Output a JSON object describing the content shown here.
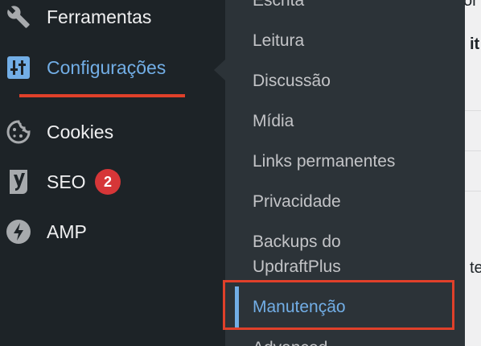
{
  "sidebar": {
    "items": [
      {
        "label": "Ferramentas",
        "icon": "wrench-icon"
      },
      {
        "label": "Configurações",
        "icon": "settings-sliders-icon",
        "active": true
      },
      {
        "label": "Cookies",
        "icon": "cookie-icon"
      },
      {
        "label": "SEO",
        "icon": "yoast-icon",
        "badge": "2"
      },
      {
        "label": "AMP",
        "icon": "amp-lightning-icon"
      }
    ]
  },
  "submenu": {
    "items": [
      {
        "label": "Escrita"
      },
      {
        "label": "Leitura"
      },
      {
        "label": "Discussão"
      },
      {
        "label": "Mídia"
      },
      {
        "label": "Links permanentes"
      },
      {
        "label": "Privacidade"
      },
      {
        "label": "Backups do"
      },
      {
        "label": "UpdraftPlus"
      },
      {
        "label": "Manutenção",
        "current": true
      },
      {
        "label": "Advanced"
      }
    ]
  },
  "content": {
    "fragments": [
      "or",
      "it",
      "te"
    ]
  },
  "colors": {
    "sidebar_bg": "#1d2327",
    "submenu_bg": "#2c3338",
    "accent": "#72aee6",
    "highlight": "#e0402a",
    "badge": "#d63638"
  }
}
